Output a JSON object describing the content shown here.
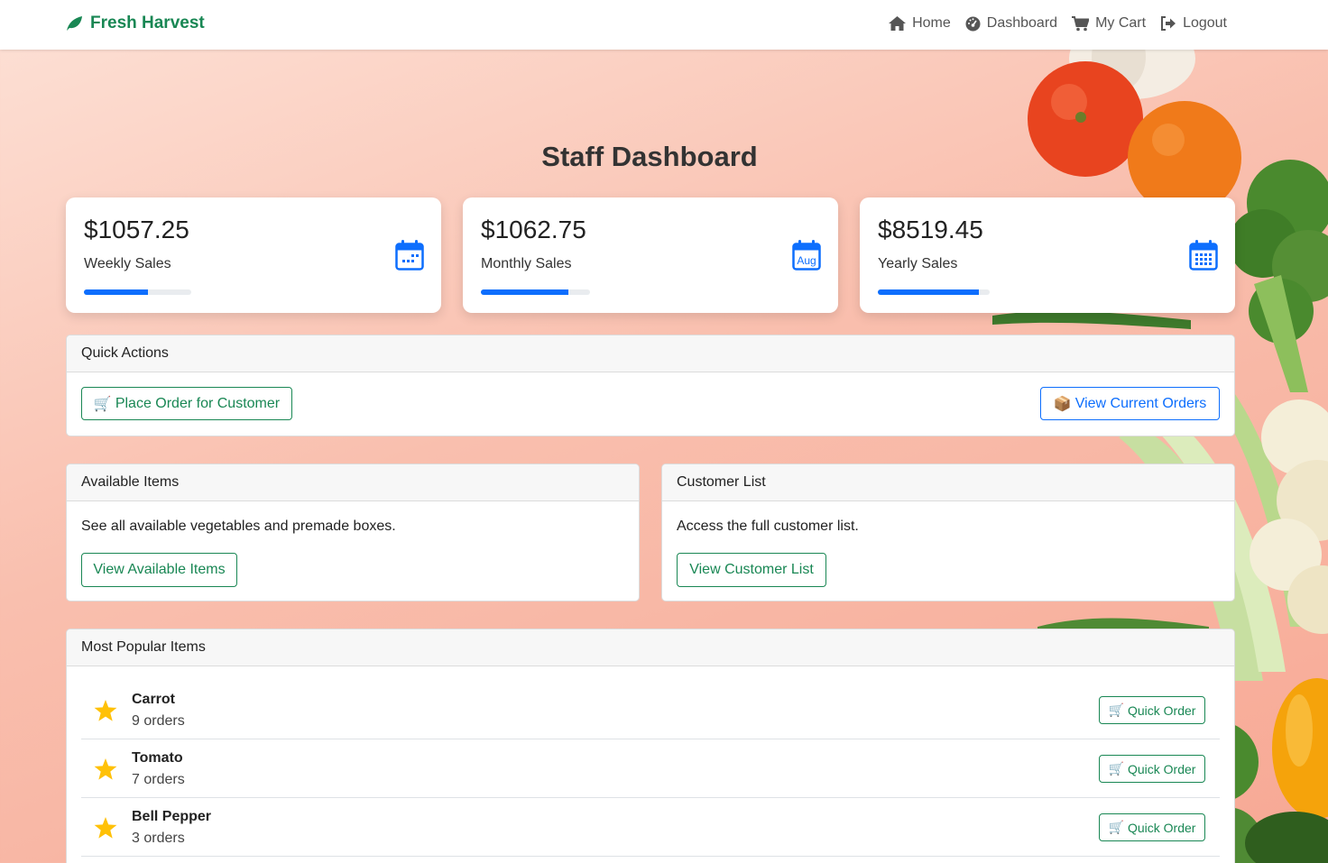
{
  "navbar": {
    "brand": "Fresh Harvest",
    "links": [
      {
        "label": "Home",
        "icon": "home-icon"
      },
      {
        "label": "Dashboard",
        "icon": "dashboard-icon"
      },
      {
        "label": "My Cart",
        "icon": "cart-icon"
      },
      {
        "label": "Logout",
        "icon": "logout-icon"
      }
    ]
  },
  "page": {
    "title": "Staff Dashboard"
  },
  "stats": [
    {
      "value": "$1057.25",
      "label": "Weekly Sales",
      "progress": 0.6,
      "icon": "calendar-week-icon"
    },
    {
      "value": "$1062.75",
      "label": "Monthly Sales",
      "progress": 0.8,
      "icon": "calendar-month-icon",
      "icon_text": "Aug"
    },
    {
      "value": "$8519.45",
      "label": "Yearly Sales",
      "progress": 0.9,
      "icon": "calendar-year-icon"
    }
  ],
  "quick_actions": {
    "title": "Quick Actions",
    "place_order": {
      "emoji": "🛒",
      "label": "Place Order for Customer"
    },
    "view_orders": {
      "emoji": "📦",
      "label": "View Current Orders"
    }
  },
  "available_items": {
    "title": "Available Items",
    "text": "See all available vegetables and premade boxes.",
    "button": "View Available Items"
  },
  "customer_list": {
    "title": "Customer List",
    "text": "Access the full customer list.",
    "button": "View Customer List"
  },
  "popular": {
    "title": "Most Popular Items",
    "quick_order_label": "Quick Order",
    "quick_order_emoji": "🛒",
    "items": [
      {
        "name": "Carrot",
        "orders": "9 orders"
      },
      {
        "name": "Tomato",
        "orders": "7 orders"
      },
      {
        "name": "Bell Pepper",
        "orders": "3 orders"
      }
    ]
  },
  "colors": {
    "brand": "#198754",
    "primary": "#0d6efd",
    "star": "#ffc107"
  }
}
